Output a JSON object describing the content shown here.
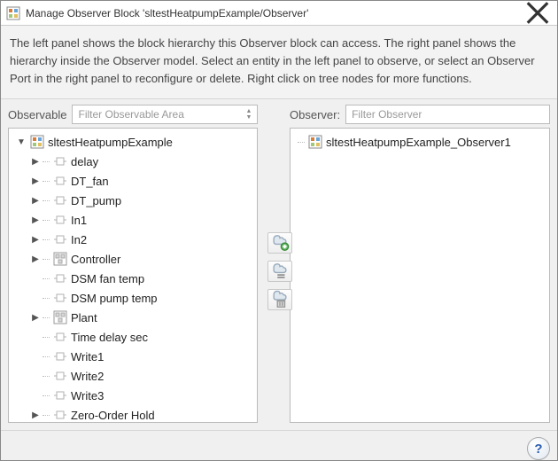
{
  "window": {
    "title": "Manage Observer Block 'sltestHeatpumpExample/Observer'"
  },
  "description": "The left panel shows the block hierarchy this Observer block can access. The right panel shows the hierarchy inside the Observer model. Select an entity in the left panel to observe, or select an Observer Port in the right panel to reconfigure or delete. Right click on tree nodes for more functions.",
  "left": {
    "label": "Observable",
    "placeholder": "Filter Observable Area",
    "root": "sltestHeatpumpExample",
    "items": [
      {
        "label": "delay",
        "icon": "block",
        "expandable": true
      },
      {
        "label": "DT_fan",
        "icon": "block",
        "expandable": true
      },
      {
        "label": "DT_pump",
        "icon": "block",
        "expandable": true
      },
      {
        "label": "In1",
        "icon": "block",
        "expandable": true
      },
      {
        "label": "In2",
        "icon": "block",
        "expandable": true
      },
      {
        "label": "Controller",
        "icon": "subsys",
        "expandable": true
      },
      {
        "label": "DSM fan temp",
        "icon": "block",
        "expandable": false
      },
      {
        "label": "DSM pump temp",
        "icon": "block",
        "expandable": false
      },
      {
        "label": "Plant",
        "icon": "subsys",
        "expandable": true
      },
      {
        "label": "Time delay sec",
        "icon": "block",
        "expandable": false
      },
      {
        "label": "Write1",
        "icon": "block",
        "expandable": false
      },
      {
        "label": "Write2",
        "icon": "block",
        "expandable": false
      },
      {
        "label": "Write3",
        "icon": "block",
        "expandable": false
      },
      {
        "label": "Zero-Order Hold",
        "icon": "block",
        "expandable": true
      }
    ]
  },
  "right": {
    "label": "Observer:",
    "placeholder": "Filter Observer",
    "root": "sltestHeatpumpExample_Observer1"
  },
  "mid_buttons": {
    "add": "add-observer-button",
    "config": "configure-observer-button",
    "delete": "delete-observer-button"
  },
  "help_label": "?"
}
